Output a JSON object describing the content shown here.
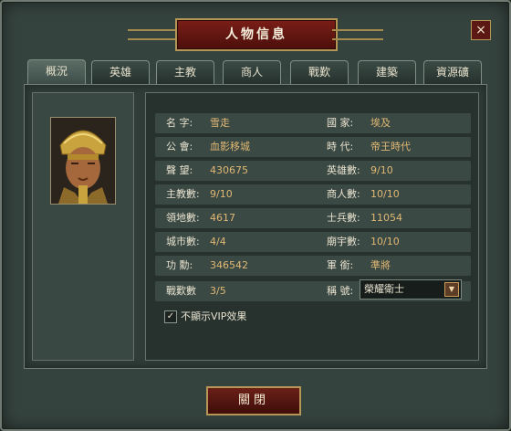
{
  "window": {
    "title": "人物信息",
    "close_label": "×"
  },
  "tabs": [
    {
      "label": "概況",
      "active": true
    },
    {
      "label": "英雄",
      "active": false
    },
    {
      "label": "主教",
      "active": false
    },
    {
      "label": "商人",
      "active": false
    },
    {
      "label": "戰歎",
      "active": false
    },
    {
      "label": "建築",
      "active": false
    },
    {
      "label": "資源礦",
      "active": false
    }
  ],
  "info": {
    "name_label": "名 字:",
    "name_value": "雪走",
    "country_label": "國 家:",
    "country_value": "埃及",
    "guild_label": "公 會:",
    "guild_value": "血影移城",
    "era_label": "時 代:",
    "era_value": "帝王時代",
    "fame_label": "聲 望:",
    "fame_value": "430675",
    "heroes_label": "英雄數:",
    "heroes_value": "9/10",
    "bishops_label": "主教數:",
    "bishops_value": "9/10",
    "merchants_label": "商人數:",
    "merchants_value": "10/10",
    "territory_label": "領地數:",
    "territory_value": "4617",
    "soldiers_label": "士兵數:",
    "soldiers_value": "11054",
    "cities_label": "城市數:",
    "cities_value": "4/4",
    "temples_label": "廟宇數:",
    "temples_value": "10/10",
    "merit_label": "功 勳:",
    "merit_value": "346542",
    "rank_label": "軍 銜:",
    "rank_value": "準將",
    "warbeast_label": "戰歎數",
    "warbeast_value": "3/5",
    "title_label": "稱 號:",
    "title_value": "榮耀衛士"
  },
  "checkbox": {
    "label": "不顯示VIP效果",
    "checked": true,
    "mark": "✓"
  },
  "close_button": {
    "label": "關閉"
  },
  "colors": {
    "value_text": "#e0b874",
    "label_text": "#e8e2cf",
    "title_bg": "#6a1a14",
    "frame_gold": "#b59656"
  }
}
